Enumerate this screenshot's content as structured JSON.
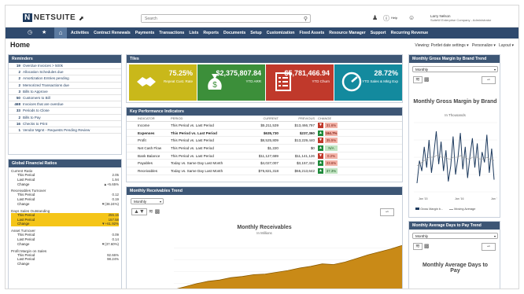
{
  "app": {
    "brand": "NETSUITE",
    "brand_mark": "N"
  },
  "search": {
    "placeholder": "Search"
  },
  "topbar": {
    "help_label": "Help",
    "user_name": "Larry Nelson",
    "user_role": "SuiteW Enterprise Company - Administrator"
  },
  "nav": {
    "items": [
      "Activities",
      "Contract Renewals",
      "Payments",
      "Transactions",
      "Lists",
      "Reports",
      "Documents",
      "Setup",
      "Customization",
      "Fixed Assets",
      "Resource Manager",
      "Support",
      "Recurring Revenue"
    ]
  },
  "page": {
    "title": "Home",
    "viewing_label": "Viewing: Portlet date settings",
    "personalize_label": "Personalize",
    "layout_label": "Layout"
  },
  "reminders": {
    "title": "Reminders",
    "items": [
      {
        "count": "19",
        "label": "Overdue Invoices > 500k"
      },
      {
        "count": "2",
        "label": "Allocation Schedules due"
      },
      {
        "count": "2",
        "label": "Amortization Entries pending"
      },
      {
        "count": "2",
        "label": "Memorized Transactions due"
      },
      {
        "count": "3",
        "label": "Bills to Approve"
      },
      {
        "count": "50",
        "label": "Customers to Bill"
      },
      {
        "count": "468",
        "label": "Invoices that are overdue"
      },
      {
        "count": "33",
        "label": "Periods to Close"
      },
      {
        "count": "2",
        "label": "Bills to Pay"
      },
      {
        "count": "16",
        "label": "Checks to Print"
      },
      {
        "count": "1",
        "label": "Vendor Mgmt - Requests Pending Review"
      }
    ]
  },
  "global_financial": {
    "title": "Global Financial Ratios",
    "groups": [
      {
        "name": "Current Ratio",
        "this_label": "This Period",
        "this": "2.05",
        "last_label": "Last Period",
        "last": "1.94",
        "change_label": "Change",
        "change": "+5.65%",
        "dir": "up",
        "highlight": false
      },
      {
        "name": "Receivables Turnover",
        "this_label": "This Period",
        "this": "0.12",
        "last_label": "Last Period",
        "last": "0.19",
        "change_label": "Change",
        "change": "(38.24%)",
        "dir": "down",
        "highlight": false
      },
      {
        "name": "Days Sales Outstanding",
        "this_label": "This Period",
        "this": "255.15",
        "last_label": "Last Period",
        "last": "157.58",
        "change_label": "Change",
        "change": "+61.92%",
        "dir": "down",
        "highlight": true
      },
      {
        "name": "Asset Turnover",
        "this_label": "This Period",
        "this": "0.09",
        "last_label": "Last Period",
        "last": "0.14",
        "change_label": "Change",
        "change": "(37.60%)",
        "dir": "down",
        "highlight": false
      },
      {
        "name": "Profit Margin on Sales",
        "this_label": "This Period",
        "this": "92.66%",
        "last_label": "Last Period",
        "last": "98.24%",
        "change_label": "Change",
        "change": "",
        "dir": "down",
        "highlight": false
      }
    ]
  },
  "tiles": {
    "title": "Tiles",
    "items": [
      {
        "value": "75.25%",
        "label": "Repeat Cust. Rate",
        "color": "#c9b81a",
        "icon": "handshake-icon"
      },
      {
        "value": "$2,375,807.84",
        "label": "YTD ARR",
        "color": "#3c8f3a",
        "icon": "money-bag-icon"
      },
      {
        "value": "$5,781,466.94",
        "label": "YTD Churn",
        "color": "#c0392b",
        "icon": "document-list-icon"
      },
      {
        "value": "28.72%",
        "label": "YTD Sales & Mktg Exp",
        "color": "#138a9e",
        "icon": "gauge-icon"
      }
    ]
  },
  "kpi": {
    "title": "Key Performance Indicators",
    "headers": [
      "INDICATOR",
      "PERIOD",
      "CURRENT",
      "PREVIOUS",
      "CHANGE"
    ],
    "rows": [
      {
        "indicator": "Income",
        "period": "This Period vs. Last Period",
        "current": "$5,211,539",
        "previous": "$13,466,797",
        "dir": "dn",
        "change": "31.6%",
        "tone": "r",
        "bold": false
      },
      {
        "indicator": "Expenses",
        "period": "This Period vs. Last Period",
        "current": "$635,730",
        "previous": "$237,360",
        "dir": "up",
        "change": "164.7%",
        "tone": "r",
        "bold": true
      },
      {
        "indicator": "Profit",
        "period": "This Period vs. Last Period",
        "current": "$8,525,809",
        "previous": "$13,229,440",
        "dir": "dn",
        "change": "35.5%",
        "tone": "r",
        "bold": false
      },
      {
        "indicator": "Net Cash Flow",
        "period": "This Period vs. Last Period",
        "current": "$1,220",
        "previous": "$0",
        "dir": "up",
        "change": "N/A",
        "tone": "g",
        "bold": false
      },
      {
        "indicator": "Bank Balance",
        "period": "This Period vs. Last Period",
        "current": "$11,127,689",
        "previous": "$11,141,126",
        "dir": "dn",
        "change": "0.2%",
        "tone": "r",
        "bold": false
      },
      {
        "indicator": "Payables",
        "period": "Today vs. Same Day Last Month",
        "current": "$4,027,007",
        "previous": "$3,157,322",
        "dir": "up",
        "change": "23.6%",
        "tone": "r",
        "bold": false
      },
      {
        "indicator": "Receivables",
        "period": "Today vs. Same Day Last Month",
        "current": "$75,821,318",
        "previous": "$55,213,642",
        "dir": "up",
        "change": "37.3%",
        "tone": "g",
        "bold": false
      }
    ]
  },
  "receivables": {
    "title": "Monthly Receivables Trend",
    "select": "Monthly",
    "chart_title": "Monthly Receivables",
    "chart_sub": "In Millions"
  },
  "gross_margin": {
    "title": "Monthly Gross Margin by Brand Trend",
    "select": "Monthly",
    "chart_title": "Monthly Gross Margin by Brand",
    "chart_sub": "In Thousands",
    "legend_a": "Gross Margin b...",
    "legend_b": "Moving Average"
  },
  "avg_days": {
    "title": "Monthly Average Days to Pay Trend",
    "select": "Monthly",
    "chart_title": "Monthly Average Days to Pay"
  },
  "chart_data": [
    {
      "type": "area",
      "title": "Monthly Receivables",
      "subtitle": "In Millions",
      "x": [
        0,
        1,
        2,
        3,
        4,
        5,
        6,
        7,
        8,
        9,
        10,
        11,
        12,
        13,
        14,
        15,
        16,
        17,
        18,
        19,
        20
      ],
      "values": [
        1.0,
        1.5,
        2.0,
        2.4,
        2.6,
        3.0,
        3.2,
        3.5,
        3.6,
        3.9,
        4.2,
        4.6,
        4.9,
        5.3,
        5.2,
        5.6,
        6.2,
        6.8,
        7.3,
        7.8,
        8.4
      ],
      "series": [
        {
          "values": [
            1.0,
            1.5,
            2.0,
            2.4,
            2.6,
            3.0,
            3.2,
            3.5,
            3.6,
            3.9,
            4.2,
            4.6,
            4.9,
            5.3,
            5.2,
            5.6,
            6.2,
            6.8,
            7.3,
            7.8,
            8.4
          ]
        }
      ],
      "ylim": [
        0,
        10
      ],
      "color": "#c98a17"
    },
    {
      "type": "line",
      "title": "Monthly Gross Margin by Brand",
      "subtitle": "In Thousands",
      "categories": [
        "Jan '15",
        "Jan '16",
        "Jan '17"
      ],
      "series": [
        {
          "name": "Gross Margin b...",
          "values": [
            0.5,
            1.8,
            1.2,
            2.6,
            1.4,
            3.0,
            1.1,
            2.2,
            3.5,
            1.6,
            2.9,
            1.2,
            2.4,
            0.6,
            1.5,
            3.2,
            1.0,
            2.0,
            3.4,
            1.3,
            2.6,
            0.8,
            2.1,
            3.1,
            1.4,
            2.8,
            0.9,
            2.3,
            1.7,
            3.3,
            1.1,
            2.5,
            0.7
          ]
        },
        {
          "name": "Moving Average",
          "values": [
            1.5,
            1.6,
            1.7,
            1.8,
            1.9,
            2.0,
            2.0,
            2.0,
            2.1,
            2.1,
            2.0,
            2.0,
            2.0,
            1.9,
            1.9,
            2.0,
            2.0,
            2.0,
            2.1,
            2.0,
            2.0,
            1.9,
            1.9,
            2.0,
            2.0,
            2.0,
            1.9,
            1.9,
            1.9,
            2.0,
            1.9,
            1.9,
            1.8
          ]
        }
      ]
    }
  ]
}
